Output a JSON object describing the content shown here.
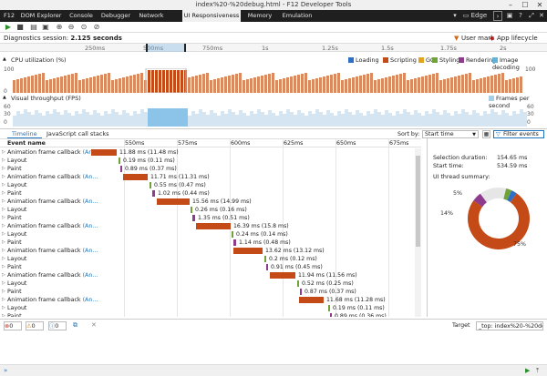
{
  "window": {
    "title": "index%20-%20debug.html - F12 Developer Tools",
    "minimize": "–",
    "maximize": "☐",
    "close": "✕"
  },
  "tabs": [
    {
      "label": "F12",
      "active": false
    },
    {
      "label": "DOM Explorer",
      "active": false
    },
    {
      "label": "Console",
      "active": false
    },
    {
      "label": "Debugger",
      "active": false
    },
    {
      "label": "Network",
      "active": false
    },
    {
      "label": "UI Responsiveness",
      "active": true
    },
    {
      "label": "Memory",
      "active": false
    },
    {
      "label": "Emulation",
      "active": false
    }
  ],
  "topright": {
    "browser": "Edge"
  },
  "diagnostics": {
    "label": "Diagnostics session:",
    "value": "2.125 seconds",
    "user_mark": "User mark",
    "app_lifecycle": "App lifecycle mark"
  },
  "ruler": [
    "250ms",
    "500ms",
    "750ms",
    "1s",
    "1.25s",
    "1.5s",
    "1.75s",
    "2s"
  ],
  "cpu": {
    "title": "CPU utilization (%)",
    "legend": [
      {
        "label": "Loading",
        "color": "#2f6fc7"
      },
      {
        "label": "Scripting",
        "color": "#c44a17"
      },
      {
        "label": "GC",
        "color": "#e6a21a"
      },
      {
        "label": "Styling",
        "color": "#6fa33a"
      },
      {
        "label": "Rendering",
        "color": "#8e3b8e"
      },
      {
        "label": "Image decoding",
        "color": "#5fb2d8"
      }
    ],
    "axis_top": "100",
    "axis_bottom": "0"
  },
  "fps": {
    "title": "Visual throughput (FPS)",
    "legend": "Frames per second",
    "axis": [
      "60",
      "30",
      "0"
    ]
  },
  "panel_tabs": [
    "Timeline",
    "JavaScript call stacks"
  ],
  "sort": {
    "label": "Sort by:",
    "value": "Start time"
  },
  "filter_label": "Filter events",
  "event_header": "Event name",
  "timeline_ticks": [
    "550ms",
    "575ms",
    "600ms",
    "625ms",
    "650ms",
    "675ms"
  ],
  "events": [
    {
      "name": "Animation frame callback",
      "suffix": "(An...",
      "type": "script",
      "dur": "11.88 ms (11.48 ms)",
      "start": 0,
      "width": 28
    },
    {
      "name": "Layout",
      "type": "style",
      "dur": "0.19 ms (0.11 ms)",
      "start": 30,
      "width": 2
    },
    {
      "name": "Paint",
      "type": "render",
      "dur": "0.89 ms (0.37 ms)",
      "start": 32,
      "width": 2
    },
    {
      "name": "Animation frame callback",
      "suffix": "(An...",
      "type": "script",
      "dur": "11.71 ms (11.31 ms)",
      "start": 35,
      "width": 27
    },
    {
      "name": "Layout",
      "type": "style",
      "dur": "0.55 ms (0.47 ms)",
      "start": 64,
      "width": 2
    },
    {
      "name": "Paint",
      "type": "render",
      "dur": "1.02 ms (0.44 ms)",
      "start": 67,
      "width": 3
    },
    {
      "name": "Animation frame callback",
      "suffix": "(An...",
      "type": "script",
      "dur": "15.56 ms (14.99 ms)",
      "start": 72,
      "width": 36
    },
    {
      "name": "Layout",
      "type": "style",
      "dur": "0.26 ms (0.16 ms)",
      "start": 109,
      "width": 2
    },
    {
      "name": "Paint",
      "type": "render",
      "dur": "1.35 ms (0.51 ms)",
      "start": 111,
      "width": 3
    },
    {
      "name": "Animation frame callback",
      "suffix": "(An...",
      "type": "script",
      "dur": "16.39 ms (15.8 ms)",
      "start": 115,
      "width": 38
    },
    {
      "name": "Layout",
      "type": "style",
      "dur": "0.24 ms (0.14 ms)",
      "start": 154,
      "width": 2
    },
    {
      "name": "Paint",
      "type": "render",
      "dur": "1.14 ms (0.48 ms)",
      "start": 156,
      "width": 3
    },
    {
      "name": "Animation frame callback",
      "suffix": "(An...",
      "type": "script",
      "dur": "13.62 ms (13.12 ms)",
      "start": 156,
      "width": 32
    },
    {
      "name": "Layout",
      "type": "style",
      "dur": "0.2 ms (0.12 ms)",
      "start": 190,
      "width": 2
    },
    {
      "name": "Paint",
      "type": "render",
      "dur": "0.91 ms (0.45 ms)",
      "start": 192,
      "width": 2
    },
    {
      "name": "Animation frame callback",
      "suffix": "(An...",
      "type": "script",
      "dur": "11.94 ms (11.56 ms)",
      "start": 196,
      "width": 28
    },
    {
      "name": "Layout",
      "type": "style",
      "dur": "0.52 ms (0.25 ms)",
      "start": 226,
      "width": 2
    },
    {
      "name": "Paint",
      "type": "render",
      "dur": "0.87 ms (0.37 ms)",
      "start": 229,
      "width": 2
    },
    {
      "name": "Animation frame callback",
      "suffix": "(An...",
      "type": "script",
      "dur": "11.68 ms (11.28 ms)",
      "start": 228,
      "width": 27
    },
    {
      "name": "Layout",
      "type": "style",
      "dur": "0.19 ms (0.11 ms)",
      "start": 260,
      "width": 2
    },
    {
      "name": "Paint",
      "type": "render",
      "dur": "0.89 ms (0.36 ms)",
      "start": 262,
      "width": 2
    }
  ],
  "details": {
    "selection_label": "Selection duration:",
    "selection_value": "154.65 ms",
    "start_label": "Start time:",
    "start_value": "534.59 ms",
    "summary_label": "UI thread summary:",
    "slices": [
      {
        "label": "75%",
        "value": 75,
        "color": "#c44a17"
      },
      {
        "label": "5%",
        "value": 5,
        "color": "#8e3b8e"
      },
      {
        "label": "14%",
        "value": 14,
        "color": "#e6e6e6"
      },
      {
        "label": "",
        "value": 3,
        "color": "#6fa33a"
      },
      {
        "label": "",
        "value": 3,
        "color": "#2f6fc7"
      }
    ]
  },
  "status": {
    "errors": "0",
    "warnings": "0",
    "info": "0",
    "target_label": "Target",
    "target_value": "_top: index%20-%20del"
  }
}
